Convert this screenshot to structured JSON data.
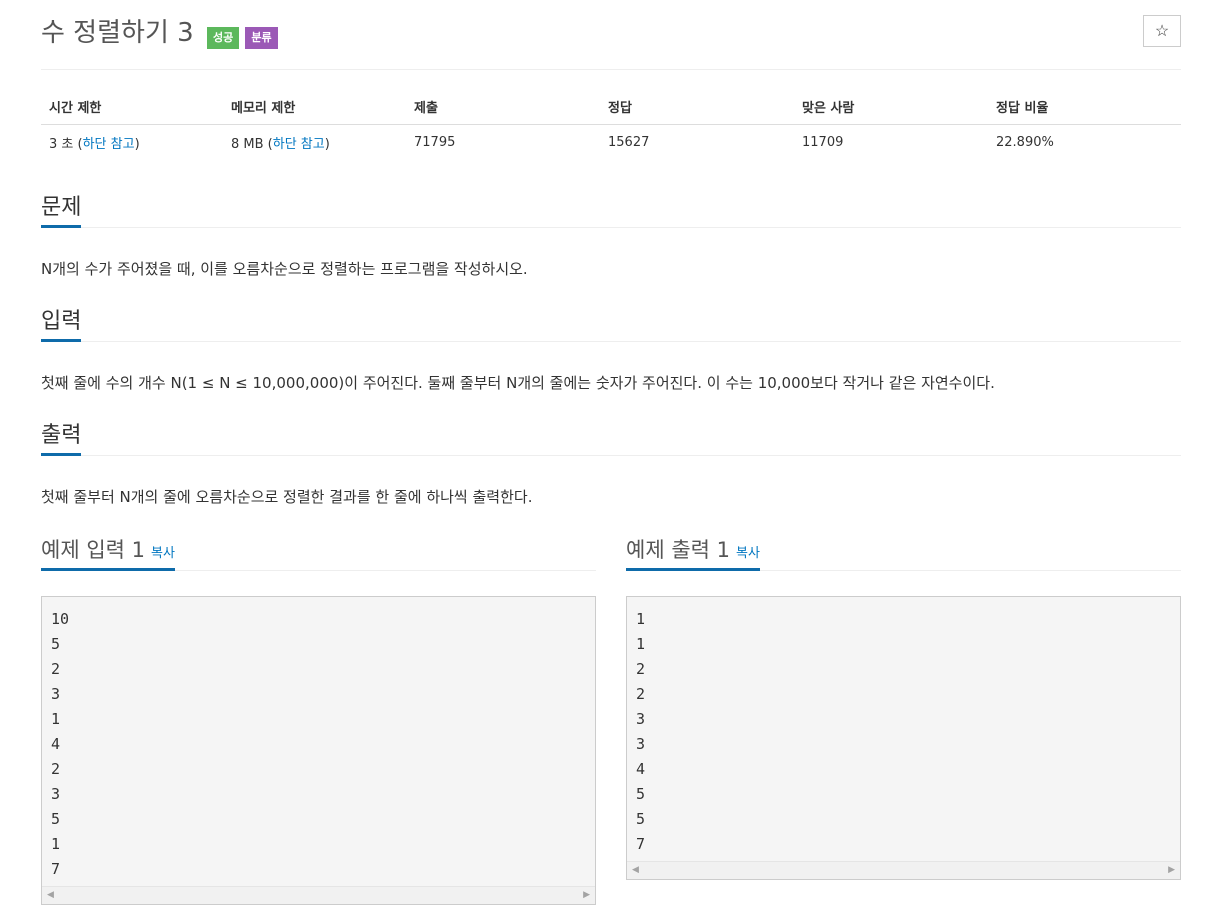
{
  "header": {
    "title": "수 정렬하기 3",
    "badges": [
      {
        "label": "성공",
        "color": "#5cb85c"
      },
      {
        "label": "분류",
        "color": "#9b59b6"
      }
    ],
    "star_label": "☆"
  },
  "info": {
    "headers": [
      "시간 제한",
      "메모리 제한",
      "제출",
      "정답",
      "맞은 사람",
      "정답 비율"
    ],
    "time_limit": {
      "value": "3 초 (",
      "link": "하단 참고",
      "close": ")"
    },
    "memory_limit": {
      "value": "8 MB (",
      "link": "하단 참고",
      "close": ")"
    },
    "submissions": "71795",
    "accepted": "15627",
    "solvers": "11709",
    "ratio": "22.890%"
  },
  "problem": {
    "heading": "문제",
    "text": "N개의 수가 주어졌을 때, 이를 오름차순으로 정렬하는 프로그램을 작성하시오."
  },
  "input": {
    "heading": "입력",
    "text": "첫째 줄에 수의 개수 N(1 ≤ N ≤ 10,000,000)이 주어진다. 둘째 줄부터 N개의 줄에는 숫자가 주어진다. 이 수는 10,000보다 작거나 같은 자연수이다."
  },
  "output": {
    "heading": "출력",
    "text": "첫째 줄부터 N개의 줄에 오름차순으로 정렬한 결과를 한 줄에 하나씩 출력한다."
  },
  "sample_input": {
    "heading": "예제 입력 1",
    "copy_label": "복사",
    "lines": [
      "10",
      "5",
      "2",
      "3",
      "1",
      "4",
      "2",
      "3",
      "5",
      "1",
      "7"
    ]
  },
  "sample_output": {
    "heading": "예제 출력 1",
    "copy_label": "복사",
    "lines": [
      "1",
      "1",
      "2",
      "2",
      "3",
      "3",
      "4",
      "5",
      "5",
      "7"
    ]
  },
  "colors": {
    "accent": "#0e6baa",
    "link": "#0076c0"
  }
}
